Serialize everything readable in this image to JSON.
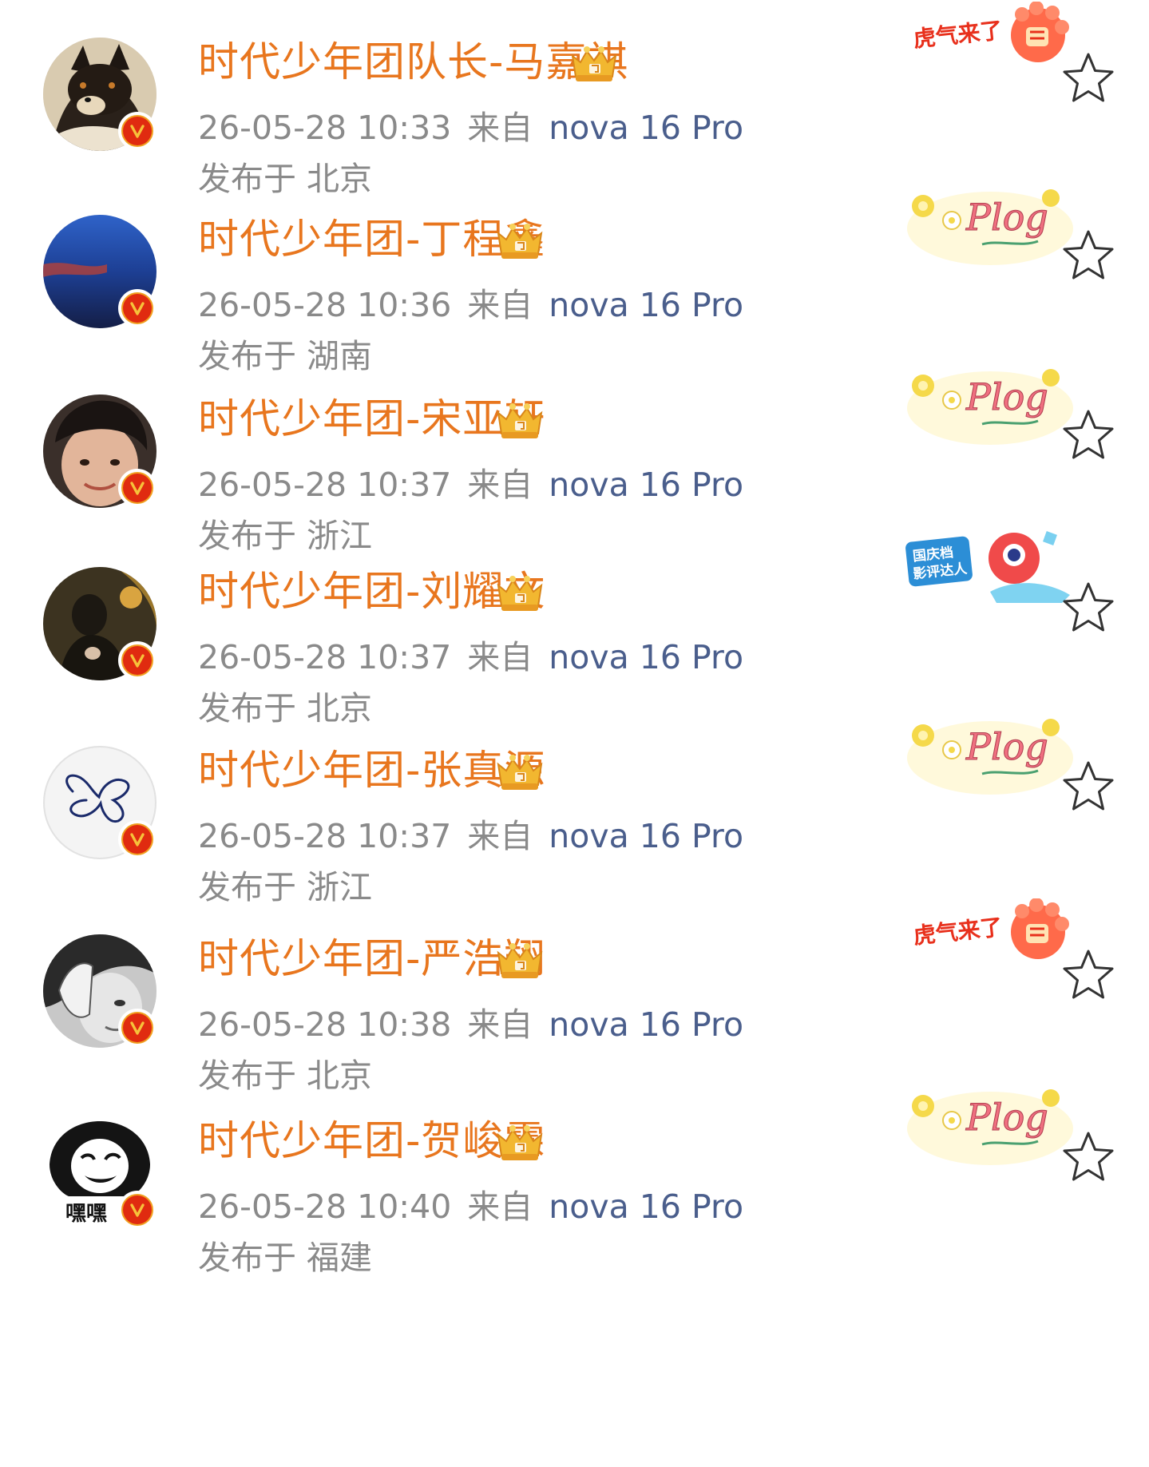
{
  "posts": [
    {
      "name": "时代少年团队长-马嘉祺",
      "time": "26-05-28 10:33",
      "source_prefix": "来自",
      "device": "nova 16 Pro",
      "location": "发布于 北京",
      "avatar_icon": "shiba-dog-avatar",
      "decoration_icon": "tiger-paw-sticker",
      "decoration_text": "虎气来了"
    },
    {
      "name": "时代少年团-丁程鑫",
      "time": "26-05-28 10:36",
      "source_prefix": "来自",
      "device": "nova 16 Pro",
      "location": "发布于 湖南",
      "avatar_icon": "blue-sky-avatar",
      "decoration_icon": "plog-flower-sticker",
      "decoration_text": "Plog"
    },
    {
      "name": "时代少年团-宋亚轩",
      "time": "26-05-28 10:37",
      "source_prefix": "来自",
      "device": "nova 16 Pro",
      "location": "发布于 浙江",
      "avatar_icon": "face-avatar",
      "decoration_icon": "plog-flower-sticker",
      "decoration_text": "Plog"
    },
    {
      "name": "时代少年团-刘耀文",
      "time": "26-05-28 10:37",
      "source_prefix": "来自",
      "device": "nova 16 Pro",
      "location": "发布于 北京",
      "avatar_icon": "dark-photo-avatar",
      "decoration_icon": "movie-critic-sticker",
      "decoration_text": "国庆档影评达人"
    },
    {
      "name": "时代少年团-张真源",
      "time": "26-05-28 10:37",
      "source_prefix": "来自",
      "device": "nova 16 Pro",
      "location": "发布于 浙江",
      "avatar_icon": "butterfly-doodle-avatar",
      "decoration_icon": "plog-flower-sticker",
      "decoration_text": "Plog"
    },
    {
      "name": "时代少年团-严浩翔",
      "time": "26-05-28 10:38",
      "source_prefix": "来自",
      "device": "nova 16 Pro",
      "location": "发布于 北京",
      "avatar_icon": "bw-photo-avatar",
      "decoration_icon": "tiger-paw-sticker",
      "decoration_text": "虎气来了"
    },
    {
      "name": "时代少年团-贺峻霖",
      "time": "26-05-28 10:40",
      "source_prefix": "来自",
      "device": "nova 16 Pro",
      "location": "发布于 福建",
      "avatar_icon": "panda-meme-avatar",
      "avatar_text": "嘿嘿",
      "decoration_icon": "plog-flower-sticker",
      "decoration_text": "Plog"
    }
  ],
  "colors": {
    "name": "#e8761e",
    "meta": "#8a8a8a",
    "device": "#4a5e8c",
    "verified_badge": "#e02b10",
    "verified_ring": "#f0a020"
  }
}
